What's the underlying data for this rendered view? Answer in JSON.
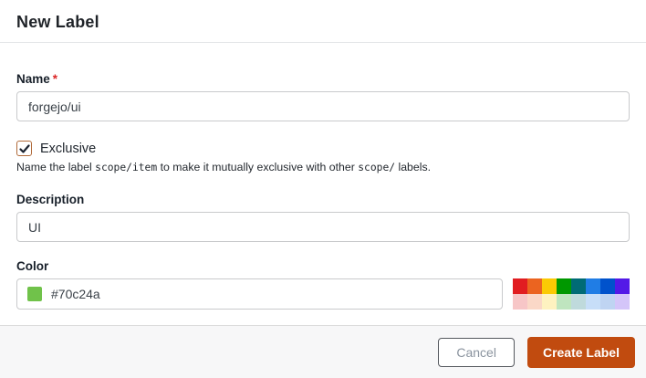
{
  "modal": {
    "title": "New Label",
    "form": {
      "name": {
        "label": "Name",
        "required_marker": "*",
        "value": "forgejo/ui"
      },
      "exclusive": {
        "label": "Exclusive",
        "checked": true,
        "help": {
          "part1": "Name the label ",
          "code1": "scope/item",
          "part2": " to make it mutually exclusive with other ",
          "code2": "scope/",
          "part3": " labels."
        }
      },
      "description": {
        "label": "Description",
        "value": "UI"
      },
      "color": {
        "label": "Color",
        "value": "#70c24a",
        "swatch_color": "#70c24a"
      }
    },
    "palette": {
      "row1": [
        "#e11d21",
        "#eb6420",
        "#fbca04",
        "#009800",
        "#006b75",
        "#207de5",
        "#0052cc",
        "#5319e7"
      ],
      "row2": [
        "#f7c6c7",
        "#fad8c7",
        "#fef2c0",
        "#bfe5bf",
        "#bfdadc",
        "#c7def8",
        "#bfd4f2",
        "#d4c5f9"
      ]
    },
    "actions": {
      "cancel_label": "Cancel",
      "submit_label": "Create Label"
    },
    "colors": {
      "primary_button": "#c14b0f",
      "required_red": "#db2828",
      "checkmark": "#1b2330"
    }
  }
}
